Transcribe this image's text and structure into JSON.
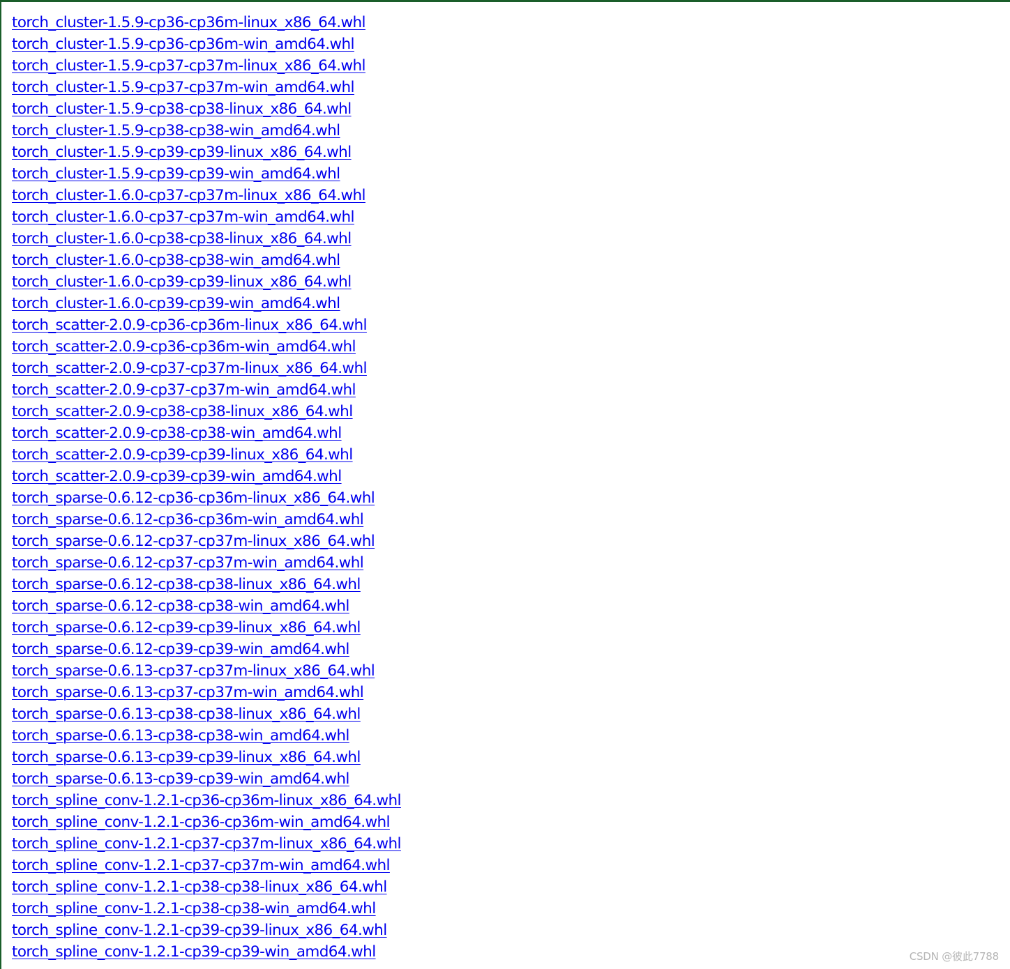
{
  "files": [
    "torch_cluster-1.5.9-cp36-cp36m-linux_x86_64.whl",
    "torch_cluster-1.5.9-cp36-cp36m-win_amd64.whl",
    "torch_cluster-1.5.9-cp37-cp37m-linux_x86_64.whl",
    "torch_cluster-1.5.9-cp37-cp37m-win_amd64.whl",
    "torch_cluster-1.5.9-cp38-cp38-linux_x86_64.whl",
    "torch_cluster-1.5.9-cp38-cp38-win_amd64.whl",
    "torch_cluster-1.5.9-cp39-cp39-linux_x86_64.whl",
    "torch_cluster-1.5.9-cp39-cp39-win_amd64.whl",
    "torch_cluster-1.6.0-cp37-cp37m-linux_x86_64.whl",
    "torch_cluster-1.6.0-cp37-cp37m-win_amd64.whl",
    "torch_cluster-1.6.0-cp38-cp38-linux_x86_64.whl",
    "torch_cluster-1.6.0-cp38-cp38-win_amd64.whl",
    "torch_cluster-1.6.0-cp39-cp39-linux_x86_64.whl",
    "torch_cluster-1.6.0-cp39-cp39-win_amd64.whl",
    "torch_scatter-2.0.9-cp36-cp36m-linux_x86_64.whl",
    "torch_scatter-2.0.9-cp36-cp36m-win_amd64.whl",
    "torch_scatter-2.0.9-cp37-cp37m-linux_x86_64.whl",
    "torch_scatter-2.0.9-cp37-cp37m-win_amd64.whl",
    "torch_scatter-2.0.9-cp38-cp38-linux_x86_64.whl",
    "torch_scatter-2.0.9-cp38-cp38-win_amd64.whl",
    "torch_scatter-2.0.9-cp39-cp39-linux_x86_64.whl",
    "torch_scatter-2.0.9-cp39-cp39-win_amd64.whl",
    "torch_sparse-0.6.12-cp36-cp36m-linux_x86_64.whl",
    "torch_sparse-0.6.12-cp36-cp36m-win_amd64.whl",
    "torch_sparse-0.6.12-cp37-cp37m-linux_x86_64.whl",
    "torch_sparse-0.6.12-cp37-cp37m-win_amd64.whl",
    "torch_sparse-0.6.12-cp38-cp38-linux_x86_64.whl",
    "torch_sparse-0.6.12-cp38-cp38-win_amd64.whl",
    "torch_sparse-0.6.12-cp39-cp39-linux_x86_64.whl",
    "torch_sparse-0.6.12-cp39-cp39-win_amd64.whl",
    "torch_sparse-0.6.13-cp37-cp37m-linux_x86_64.whl",
    "torch_sparse-0.6.13-cp37-cp37m-win_amd64.whl",
    "torch_sparse-0.6.13-cp38-cp38-linux_x86_64.whl",
    "torch_sparse-0.6.13-cp38-cp38-win_amd64.whl",
    "torch_sparse-0.6.13-cp39-cp39-linux_x86_64.whl",
    "torch_sparse-0.6.13-cp39-cp39-win_amd64.whl",
    "torch_spline_conv-1.2.1-cp36-cp36m-linux_x86_64.whl",
    "torch_spline_conv-1.2.1-cp36-cp36m-win_amd64.whl",
    "torch_spline_conv-1.2.1-cp37-cp37m-linux_x86_64.whl",
    "torch_spline_conv-1.2.1-cp37-cp37m-win_amd64.whl",
    "torch_spline_conv-1.2.1-cp38-cp38-linux_x86_64.whl",
    "torch_spline_conv-1.2.1-cp38-cp38-win_amd64.whl",
    "torch_spline_conv-1.2.1-cp39-cp39-linux_x86_64.whl",
    "torch_spline_conv-1.2.1-cp39-cp39-win_amd64.whl"
  ],
  "watermark": "CSDN @彼此7788",
  "colors": {
    "link": "#0000ee",
    "frame_border": "#1a5e2a",
    "watermark": "#b5b5b5",
    "background": "#ffffff"
  }
}
